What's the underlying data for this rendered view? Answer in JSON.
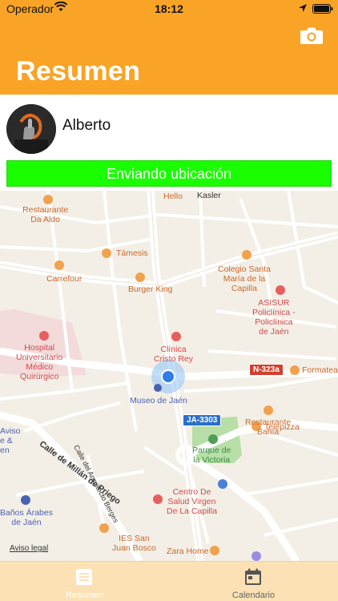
{
  "status_bar": {
    "carrier": "Operador",
    "time": "18:12"
  },
  "header": {
    "title": "Resumen",
    "camera_icon": "camera-icon"
  },
  "profile": {
    "name": "Alberto"
  },
  "location_status": {
    "text": "Enviando ubicación",
    "color": "#19FF00"
  },
  "map": {
    "labels": {
      "hello": "Hello",
      "kasler": "Kasler",
      "restaurante_aldo": "Restaurante\nDa Aldo",
      "tamesis": "Támesis",
      "carrefour": "Carrefour",
      "burger_king": "Burger King",
      "colegio": "Colegio Santa\nMaría de la\nCapilla",
      "asisur": "ASISUR\nPoliclínica -\nPoliclínica\nde Jaén",
      "hospital": "Hospital\nUniversitario\nMédico\nQuirúrgico",
      "clinica": "Clínica\nCristo Rey",
      "museo": "Museo de Jaén",
      "formatea": "Formatea",
      "restaurante_bahia": "Restaurante\nBahía",
      "telepizza": "Telepizza",
      "parque": "Parque de\nla Victoria",
      "calle_arquitecto": "Calle del Arquitecto Berges",
      "calle_millan": "Calle de Millán de Priego",
      "centro_salud": "Centro De\nSalud Virgen\nDe La Capilla",
      "banos": "Baños Árabes\nde Jaén",
      "ies": "IES San\nJuan Bosco",
      "zara": "Zara Home",
      "aviso_partial": "Aviso\ne &\nen"
    },
    "road_badges": {
      "n323a": "N-323a",
      "ja3303": "JA-3303"
    },
    "legal": "Aviso legal"
  },
  "tabbar": {
    "tabs": [
      {
        "label": "Resumen",
        "icon": "list-icon",
        "active": true
      },
      {
        "label": "Calendario",
        "icon": "calendar-icon",
        "active": false
      }
    ]
  },
  "colors": {
    "header": "#F9A426",
    "tabbar": "#FBE1B4",
    "accent_green": "#19FF00"
  }
}
